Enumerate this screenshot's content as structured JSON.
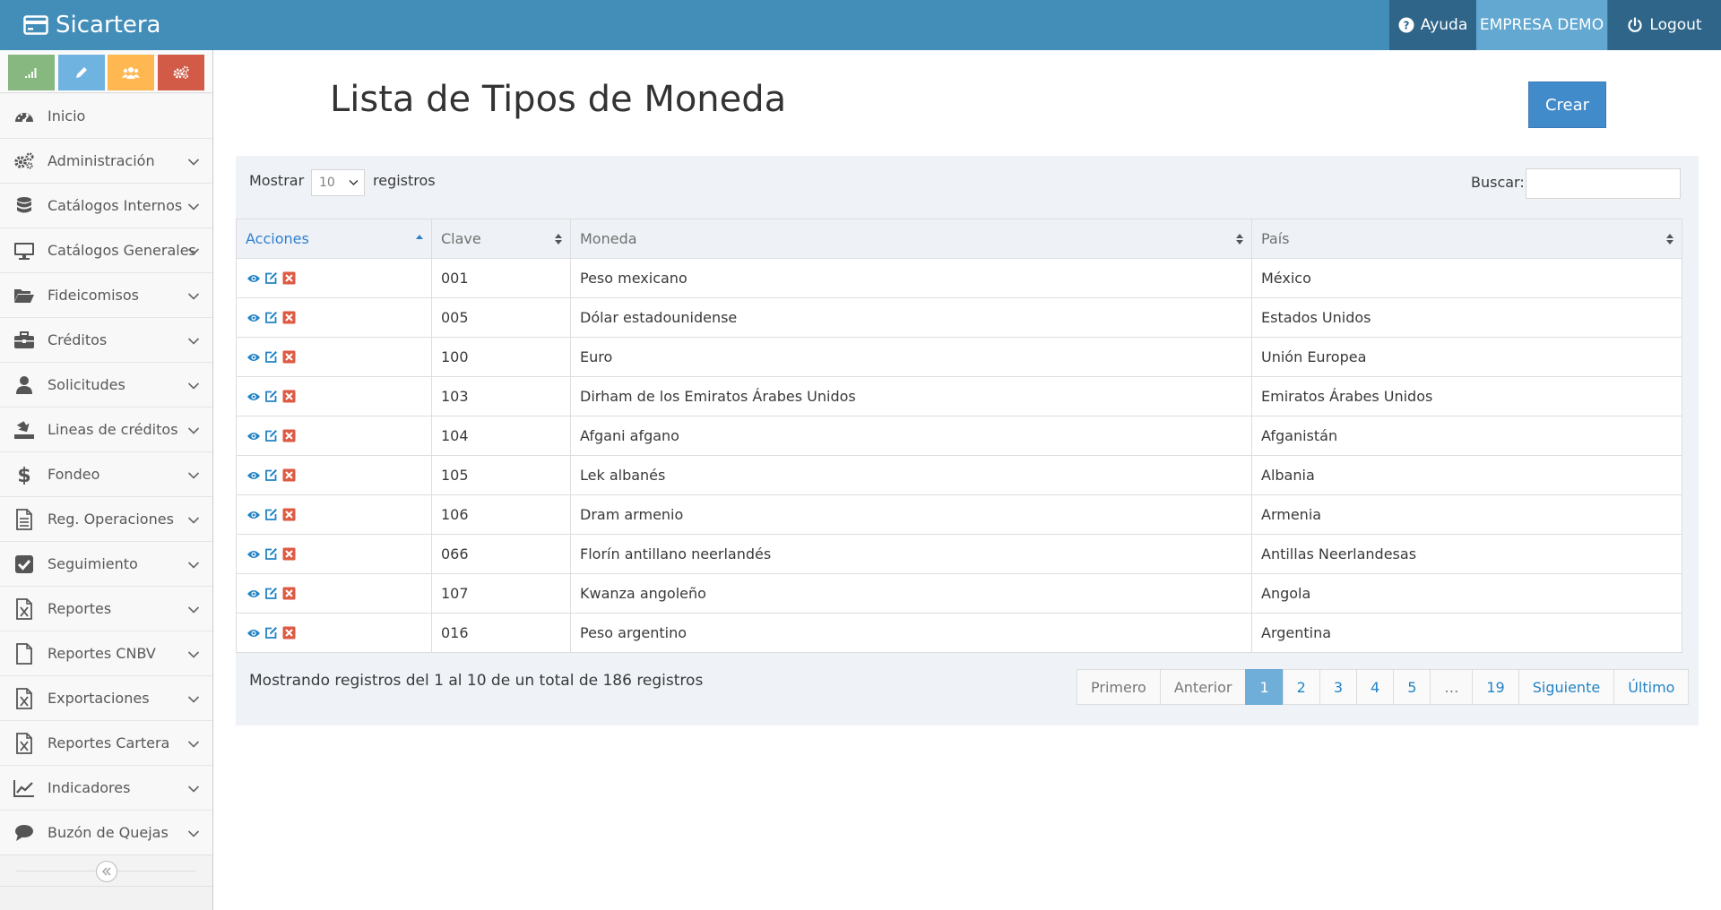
{
  "navbar": {
    "brand": "Sicartera",
    "help": "Ayuda",
    "company": "EMPRESA DEMO",
    "logout": "Logout"
  },
  "sidebar": {
    "shortcuts": [
      {
        "icon": "signal-icon",
        "color": "#87b87f"
      },
      {
        "icon": "pencil-icon",
        "color": "#6fb3e0"
      },
      {
        "icon": "users-icon",
        "color": "#ffb752"
      },
      {
        "icon": "cogs-icon",
        "color": "#d15b47"
      }
    ],
    "items": [
      {
        "label": "Inicio",
        "icon": "dashboard-icon",
        "has_submenu": false
      },
      {
        "label": "Administración",
        "icon": "cogs-icon",
        "has_submenu": true
      },
      {
        "label": "Catálogos Internos",
        "icon": "database-icon",
        "has_submenu": true
      },
      {
        "label": "Catálogos Generales",
        "icon": "desktop-icon",
        "has_submenu": true
      },
      {
        "label": "Fideicomisos",
        "icon": "folder-open-icon",
        "has_submenu": true
      },
      {
        "label": "Créditos",
        "icon": "briefcase-icon",
        "has_submenu": true
      },
      {
        "label": "Solicitudes",
        "icon": "user-icon",
        "has_submenu": true
      },
      {
        "label": "Lineas de créditos",
        "icon": "download-tray-icon",
        "has_submenu": true
      },
      {
        "label": "Fondeo",
        "icon": "dollar-icon",
        "has_submenu": true
      },
      {
        "label": "Reg. Operaciones",
        "icon": "file-text-icon",
        "has_submenu": true
      },
      {
        "label": "Seguimiento",
        "icon": "check-square-icon",
        "has_submenu": true
      },
      {
        "label": "Reportes",
        "icon": "file-excel-icon",
        "has_submenu": true
      },
      {
        "label": "Reportes CNBV",
        "icon": "file-icon",
        "has_submenu": true
      },
      {
        "label": "Exportaciones",
        "icon": "file-excel-icon",
        "has_submenu": true
      },
      {
        "label": "Reportes Cartera",
        "icon": "file-excel-icon",
        "has_submenu": true
      },
      {
        "label": "Indicadores",
        "icon": "line-chart-icon",
        "has_submenu": true
      },
      {
        "label": "Buzón de Quejas",
        "icon": "comment-icon",
        "has_submenu": true
      }
    ]
  },
  "main": {
    "title": "Lista de Tipos de Moneda",
    "create_label": "Crear",
    "show_label": "Mostrar",
    "page_size": "10",
    "records_label": "registros",
    "search_label": "Buscar:",
    "search_value": "",
    "columns": [
      "Acciones",
      "Clave",
      "Moneda",
      "País"
    ],
    "rows": [
      {
        "clave": "001",
        "moneda": "Peso mexicano",
        "pais": "México"
      },
      {
        "clave": "005",
        "moneda": "Dólar estadounidense",
        "pais": "Estados Unidos"
      },
      {
        "clave": "100",
        "moneda": "Euro",
        "pais": "Unión Europea"
      },
      {
        "clave": "103",
        "moneda": "Dirham de los Emiratos Árabes Unidos",
        "pais": "Emiratos Árabes Unidos"
      },
      {
        "clave": "104",
        "moneda": "Afgani afgano",
        "pais": "Afganistán"
      },
      {
        "clave": "105",
        "moneda": "Lek albanés",
        "pais": "Albania"
      },
      {
        "clave": "106",
        "moneda": "Dram armenio",
        "pais": "Armenia"
      },
      {
        "clave": "066",
        "moneda": "Florín antillano neerlandés",
        "pais": "Antillas Neerlandesas"
      },
      {
        "clave": "107",
        "moneda": "Kwanza angoleño",
        "pais": "Angola"
      },
      {
        "clave": "016",
        "moneda": "Peso argentino",
        "pais": "Argentina"
      }
    ],
    "info_text": "Mostrando registros del 1 al 10 de un total de 186 registros",
    "pagination": {
      "first": "Primero",
      "prev": "Anterior",
      "pages": [
        "1",
        "2",
        "3",
        "4",
        "5",
        "…",
        "19"
      ],
      "next": "Siguiente",
      "last": "Último",
      "active": "1"
    }
  },
  "colors": {
    "navbar": "#438eb9",
    "accent": "#307ecc",
    "create_button": "#428bca",
    "delete_icon": "#dd5a43",
    "active_page": "#6faed9"
  }
}
